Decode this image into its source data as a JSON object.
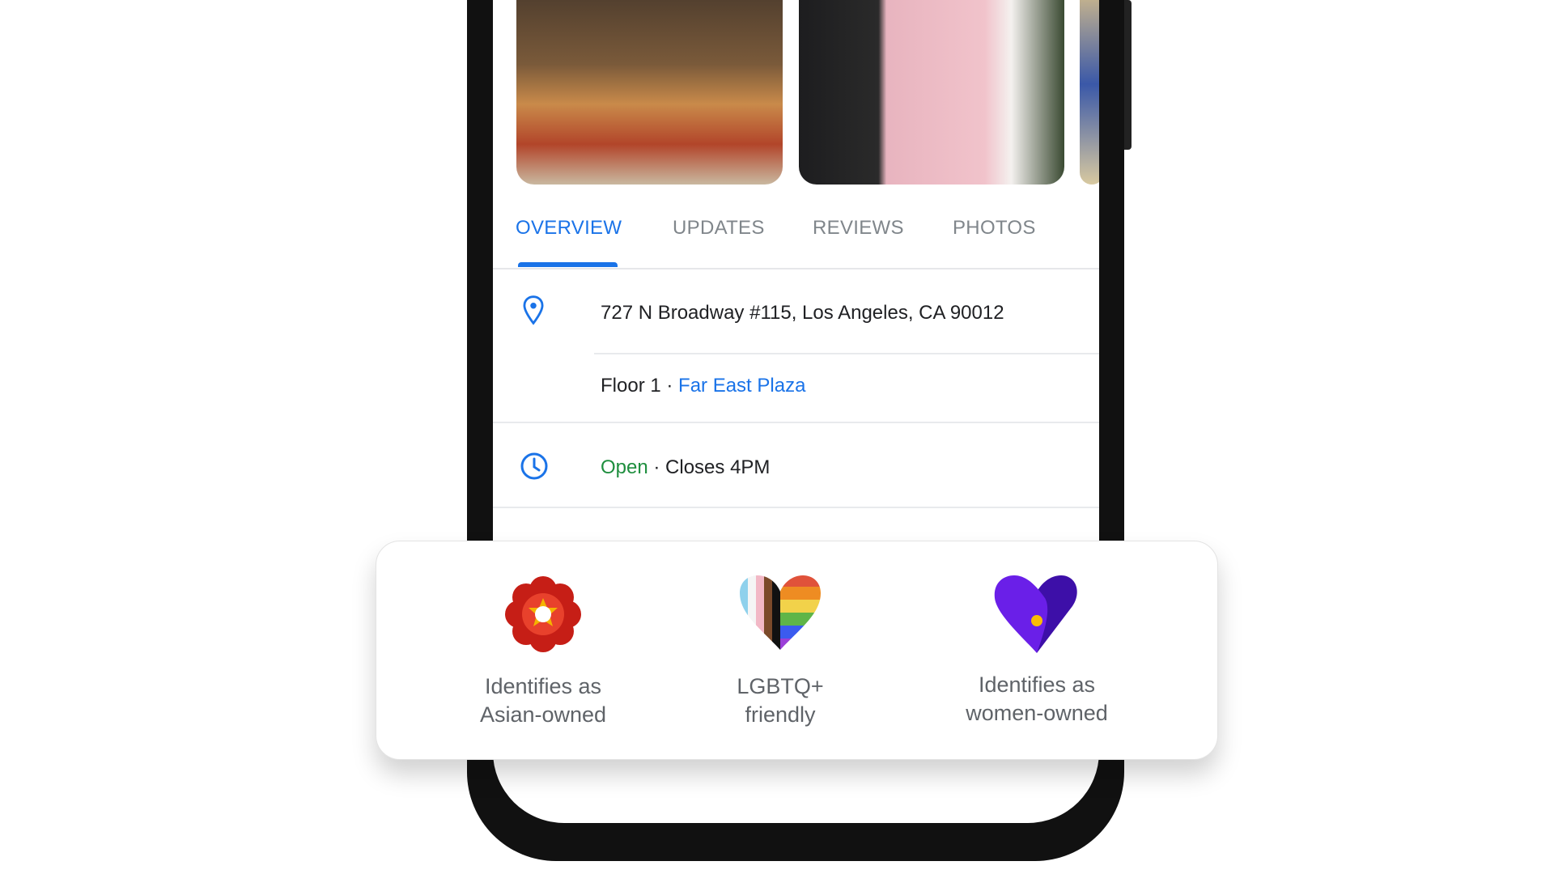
{
  "tabs": [
    {
      "label": "OVERVIEW",
      "active": true
    },
    {
      "label": "UPDATES"
    },
    {
      "label": "REVIEWS"
    },
    {
      "label": "PHOTOS"
    }
  ],
  "address": {
    "icon": "location-pin-icon",
    "text": "727 N Broadway #115, Los Angeles, CA 90012"
  },
  "floor": {
    "text": "Floor 1 · ",
    "link": "Far East Plaza"
  },
  "hours": {
    "icon": "clock-icon",
    "status": "Open",
    "detail": " · Closes 4PM"
  },
  "attributes": [
    {
      "icon": "asian-owned-flower-icon",
      "line1": "Identifies as",
      "line2": "Asian-owned"
    },
    {
      "icon": "lgbtq-heart-icon",
      "line1": "LGBTQ+",
      "line2": "friendly"
    },
    {
      "icon": "women-owned-heart-icon",
      "line1": "Identifies as",
      "line2": "women-owned"
    }
  ],
  "colors": {
    "accent": "#1a73e8",
    "open": "#1e8e3e",
    "women_owned": "#6a1fe8"
  }
}
